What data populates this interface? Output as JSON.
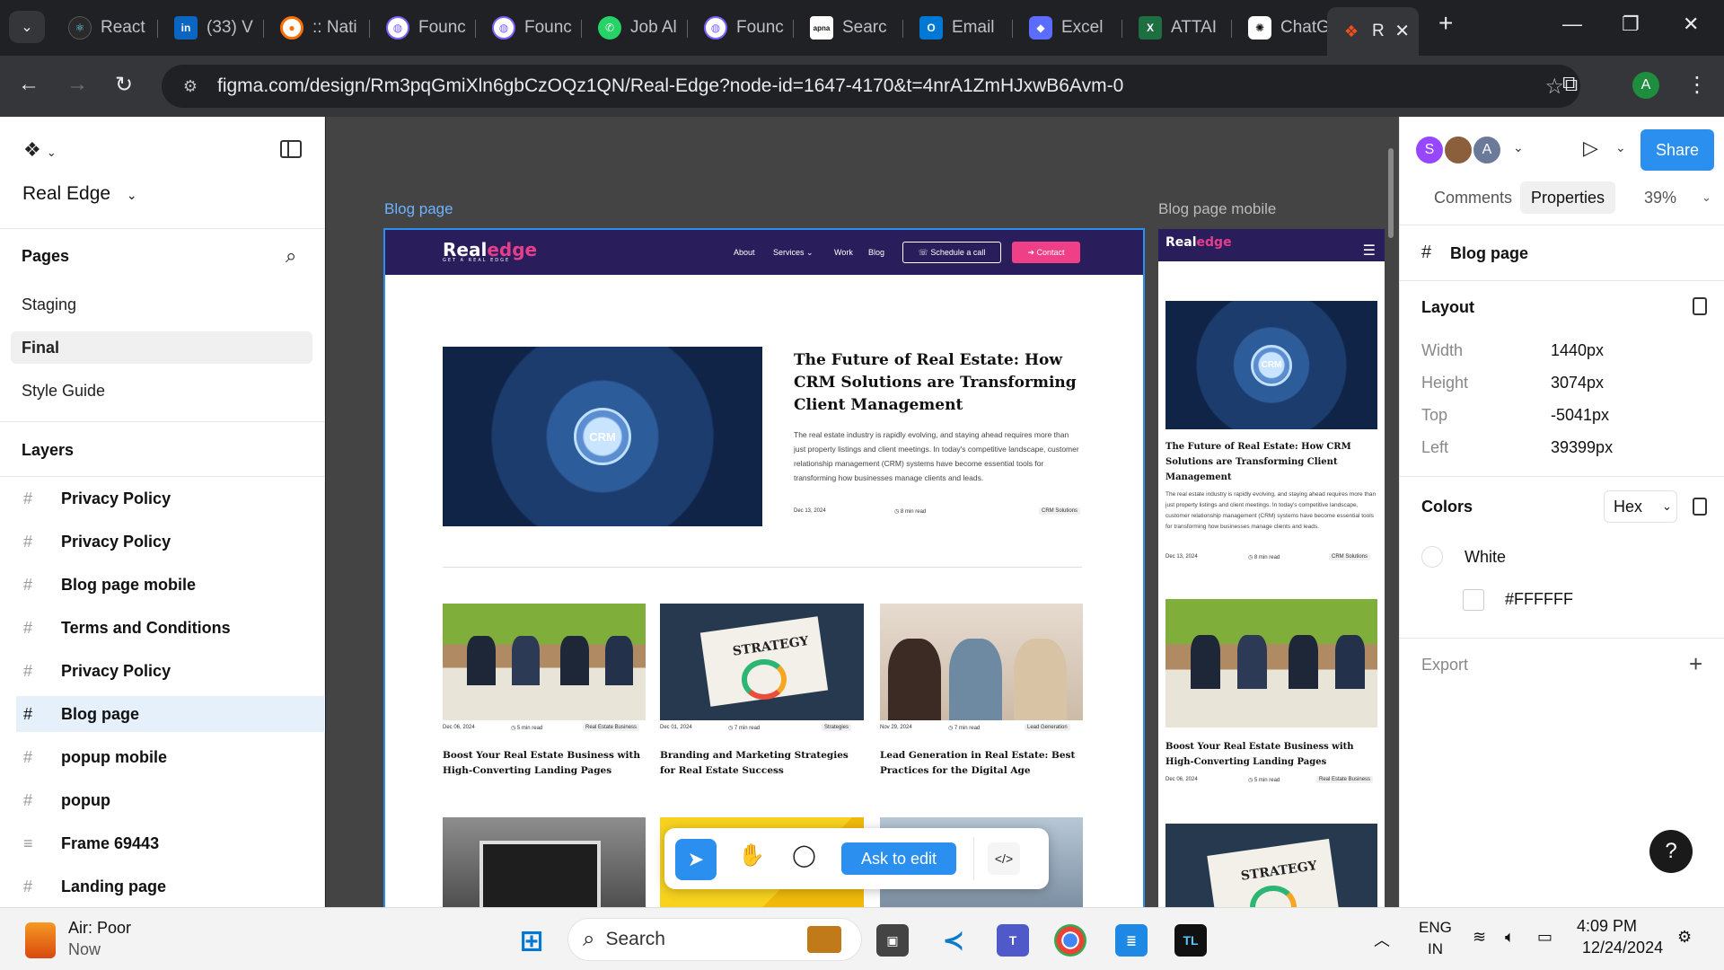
{
  "browser": {
    "tabs": [
      {
        "title": "React",
        "icon": "react-icon",
        "color": "#61dafb"
      },
      {
        "title": "(33) V",
        "icon": "linkedin-icon",
        "color": "#0a66c2"
      },
      {
        "title": ":: Nati",
        "icon": "app-icon",
        "color": "#ff6f00"
      },
      {
        "title": "Founc",
        "icon": "swirl-icon",
        "color": "#7b61ff"
      },
      {
        "title": "Founc",
        "icon": "swirl-icon",
        "color": "#7b61ff"
      },
      {
        "title": "Job Al",
        "icon": "whatsapp-icon",
        "color": "#25d366"
      },
      {
        "title": "Founc",
        "icon": "swirl-icon",
        "color": "#7b61ff"
      },
      {
        "title": "Searc",
        "icon": "apna-icon",
        "color": "#ffffff"
      },
      {
        "title": "Email",
        "icon": "outlook-icon",
        "color": "#0078d4"
      },
      {
        "title": "Excel",
        "icon": "copilot-icon",
        "color": "#5b6cff"
      },
      {
        "title": "ATTAI",
        "icon": "excel-icon",
        "color": "#1d6f42"
      },
      {
        "title": "ChatG",
        "icon": "chatgpt-icon",
        "color": "#ffffff"
      },
      {
        "title": "R",
        "icon": "figma-icon",
        "color": "#f24e1e"
      }
    ],
    "url": "figma.com/design/Rm3pqGmiXln6gbCzOQz1QN/Real-Edge?node-id=1647-4170&t=4nrA1ZmHJxwB6Avm-0",
    "profile_initial": "A"
  },
  "left_panel": {
    "file_name": "Real Edge",
    "pages_title": "Pages",
    "pages": [
      "Staging",
      "Final",
      "Style Guide"
    ],
    "layers_title": "Layers",
    "layers": [
      {
        "name": "Privacy Policy",
        "icon": "#"
      },
      {
        "name": "Privacy Policy",
        "icon": "#"
      },
      {
        "name": "Blog page mobile",
        "icon": "#"
      },
      {
        "name": "Terms and Conditions",
        "icon": "#"
      },
      {
        "name": "Privacy Policy",
        "icon": "#"
      },
      {
        "name": "Blog page",
        "icon": "#"
      },
      {
        "name": "popup mobile",
        "icon": "#"
      },
      {
        "name": "popup",
        "icon": "#"
      },
      {
        "name": "Frame 69443",
        "icon": "≡"
      },
      {
        "name": "Landing page",
        "icon": "#"
      }
    ]
  },
  "canvas": {
    "desktop_label": "Blog page",
    "mobile_label": "Blog page mobile",
    "site": {
      "logo_main": "Real",
      "logo_accent": "edge",
      "logo_tagline": "GET A REAL EDGE",
      "nav": [
        "About",
        "Services ⌄",
        "Work",
        "Blog"
      ],
      "schedule_btn": "☏ Schedule a call",
      "contact_btn": "➜ Contact",
      "featured": {
        "title": "The Future of Real Estate: How CRM Solutions are Transforming Client Management",
        "body": "The real estate industry is rapidly evolving, and staying ahead requires more than just property listings and client meetings. In today's competitive landscape, customer relationship management (CRM) systems have become essential tools for transforming how businesses manage clients and leads.",
        "date": "Dec 13, 2024",
        "read": "8 min read",
        "tag": "CRM Solutions",
        "img_label": "CRM"
      },
      "posts": [
        {
          "date": "Dec 06, 2024",
          "read": "5 min read",
          "tag": "Real Estate Business",
          "title": "Boost Your Real Estate Business with High-Converting Landing Pages"
        },
        {
          "date": "Dec 01, 2024",
          "read": "7 min read",
          "tag": "Strategies",
          "title": "Branding and Marketing Strategies for Real Estate Success",
          "img_label": "STRATEGY"
        },
        {
          "date": "Nov 29, 2024",
          "read": "7 min read",
          "tag": "Lead Generation",
          "title": "Lead Generation in Real Estate: Best Practices for the Digital Age"
        }
      ]
    }
  },
  "toolbar": {
    "ask_label": "Ask to edit",
    "code_label": "</>"
  },
  "right_panel": {
    "avatars": [
      {
        "initial": "S",
        "color": "#9747ff"
      },
      {
        "initial": "",
        "color": "#8b5e3c"
      },
      {
        "initial": "A",
        "color": "#6b7a99"
      }
    ],
    "share_label": "Share",
    "tabs": [
      "Comments",
      "Properties"
    ],
    "zoom": "39%",
    "selection_name": "Blog page",
    "layout_title": "Layout",
    "layout": [
      {
        "k": "Width",
        "v": "1440px"
      },
      {
        "k": "Height",
        "v": "3074px"
      },
      {
        "k": "Top",
        "v": "-5041px"
      },
      {
        "k": "Left",
        "v": "39399px"
      }
    ],
    "colors_title": "Colors",
    "color_format": "Hex",
    "color_name": "White",
    "color_hex": "#FFFFFF",
    "export_title": "Export"
  },
  "taskbar": {
    "weather_title": "Air: Poor",
    "weather_sub": "Now",
    "search_label": "Search",
    "lang_top": "ENG",
    "lang_bottom": "IN",
    "time": "4:09 PM",
    "date": "12/24/2024"
  }
}
